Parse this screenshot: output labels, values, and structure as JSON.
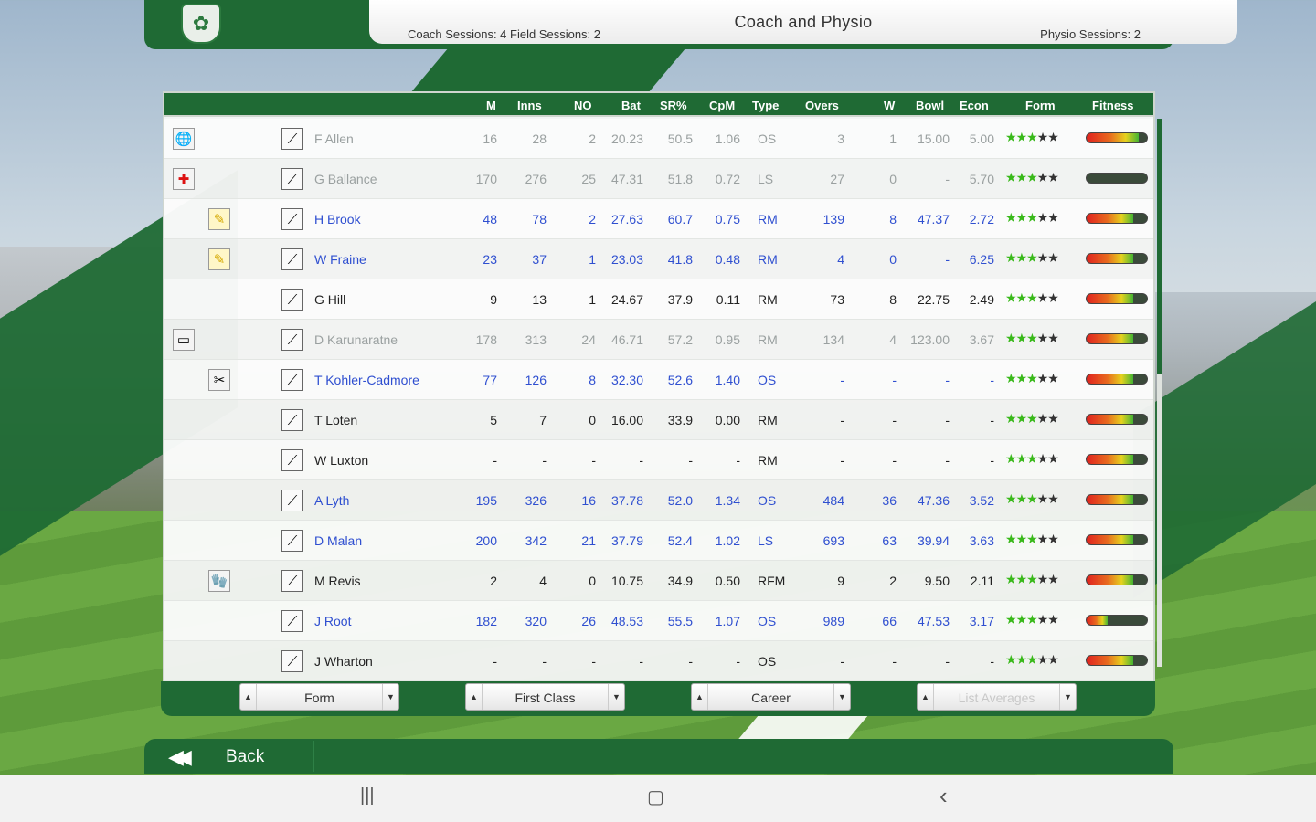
{
  "header": {
    "title": "Coach and Physio",
    "coach_field": "Coach Sessions: 4  Field Sessions: 2",
    "physio": "Physio Sessions: 2"
  },
  "columns": [
    "M",
    "Inns",
    "NO",
    "Bat",
    "SR%",
    "CpM",
    "Type",
    "Overs",
    "W",
    "Bowl",
    "Econ",
    "Form",
    "Fitness"
  ],
  "icons": {
    "globe": "globe-icon",
    "medical": "medical-cross-icon",
    "pencil": "pencil-icon",
    "bat": "bat-icon",
    "wicket": "wicket-icon",
    "keeper": "keeper-gloves-icon",
    "injury": "injury-icon",
    "card": "card-icon"
  },
  "rows": [
    {
      "icon1": "🌐",
      "icon2": "",
      "role": "⟋",
      "name": "F Allen",
      "m": "16",
      "inns": "28",
      "no": "2",
      "bat": "20.23",
      "sr": "50.5",
      "cpm": "1.06",
      "type": "OS",
      "overs": "3",
      "w": "1",
      "bowl": "15.00",
      "econ": "5.00",
      "form": 3,
      "fitness": 0.86,
      "style": "faded"
    },
    {
      "icon1": "✚",
      "icon2": "",
      "role": "⟋",
      "name": "G Ballance",
      "m": "170",
      "inns": "276",
      "no": "25",
      "bat": "47.31",
      "sr": "51.8",
      "cpm": "0.72",
      "type": "LS",
      "overs": "27",
      "w": "0",
      "bowl": "-",
      "econ": "5.70",
      "form": 3,
      "fitness": 0.0,
      "style": "faded"
    },
    {
      "icon1": "",
      "icon2": "✎",
      "role": "⟋",
      "name": "H Brook",
      "m": "48",
      "inns": "78",
      "no": "2",
      "bat": "27.63",
      "sr": "60.7",
      "cpm": "0.75",
      "type": "RM",
      "overs": "139",
      "w": "8",
      "bowl": "47.37",
      "econ": "2.72",
      "form": 3,
      "fitness": 0.78,
      "style": "blue"
    },
    {
      "icon1": "",
      "icon2": "✎",
      "role": "⟋",
      "name": "W Fraine",
      "m": "23",
      "inns": "37",
      "no": "1",
      "bat": "23.03",
      "sr": "41.8",
      "cpm": "0.48",
      "type": "RM",
      "overs": "4",
      "w": "0",
      "bowl": "-",
      "econ": "6.25",
      "form": 3,
      "fitness": 0.78,
      "style": "blue"
    },
    {
      "icon1": "",
      "icon2": "",
      "role": "⟋",
      "name": "G Hill",
      "m": "9",
      "inns": "13",
      "no": "1",
      "bat": "24.67",
      "sr": "37.9",
      "cpm": "0.11",
      "type": "RM",
      "overs": "73",
      "w": "8",
      "bowl": "22.75",
      "econ": "2.49",
      "form": 3,
      "fitness": 0.78,
      "style": "plain"
    },
    {
      "icon1": "▭",
      "icon2": "",
      "role": "⟋",
      "name": "D Karunaratne",
      "m": "178",
      "inns": "313",
      "no": "24",
      "bat": "46.71",
      "sr": "57.2",
      "cpm": "0.95",
      "type": "RM",
      "overs": "134",
      "w": "4",
      "bowl": "123.00",
      "econ": "3.67",
      "form": 3,
      "fitness": 0.78,
      "style": "faded"
    },
    {
      "icon1": "",
      "icon2": "✂",
      "role": "⟋",
      "name": "T Kohler-Cadmore",
      "m": "77",
      "inns": "126",
      "no": "8",
      "bat": "32.30",
      "sr": "52.6",
      "cpm": "1.40",
      "type": "OS",
      "overs": "-",
      "w": "-",
      "bowl": "-",
      "econ": "-",
      "form": 3,
      "fitness": 0.78,
      "style": "blue"
    },
    {
      "icon1": "",
      "icon2": "",
      "role": "⟋",
      "name": "T Loten",
      "m": "5",
      "inns": "7",
      "no": "0",
      "bat": "16.00",
      "sr": "33.9",
      "cpm": "0.00",
      "type": "RM",
      "overs": "-",
      "w": "-",
      "bowl": "-",
      "econ": "-",
      "form": 3,
      "fitness": 0.78,
      "style": "plain"
    },
    {
      "icon1": "",
      "icon2": "",
      "role": "⟋",
      "name": "W Luxton",
      "m": "-",
      "inns": "-",
      "no": "-",
      "bat": "-",
      "sr": "-",
      "cpm": "-",
      "type": "RM",
      "overs": "-",
      "w": "-",
      "bowl": "-",
      "econ": "-",
      "form": 3,
      "fitness": 0.78,
      "style": "plain"
    },
    {
      "icon1": "",
      "icon2": "",
      "role": "⟋",
      "name": "A Lyth",
      "m": "195",
      "inns": "326",
      "no": "16",
      "bat": "37.78",
      "sr": "52.0",
      "cpm": "1.34",
      "type": "OS",
      "overs": "484",
      "w": "36",
      "bowl": "47.36",
      "econ": "3.52",
      "form": 3,
      "fitness": 0.78,
      "style": "blue"
    },
    {
      "icon1": "",
      "icon2": "",
      "role": "⟋",
      "name": "D Malan",
      "m": "200",
      "inns": "342",
      "no": "21",
      "bat": "37.79",
      "sr": "52.4",
      "cpm": "1.02",
      "type": "LS",
      "overs": "693",
      "w": "63",
      "bowl": "39.94",
      "econ": "3.63",
      "form": 3,
      "fitness": 0.78,
      "style": "blue"
    },
    {
      "icon1": "",
      "icon2": "🧤",
      "role": "⟋",
      "name": "M Revis",
      "m": "2",
      "inns": "4",
      "no": "0",
      "bat": "10.75",
      "sr": "34.9",
      "cpm": "0.50",
      "type": "RFM",
      "overs": "9",
      "w": "2",
      "bowl": "9.50",
      "econ": "2.11",
      "form": 3,
      "fitness": 0.78,
      "style": "plain"
    },
    {
      "icon1": "",
      "icon2": "",
      "role": "⟋",
      "name": "J Root",
      "m": "182",
      "inns": "320",
      "no": "26",
      "bat": "48.53",
      "sr": "55.5",
      "cpm": "1.07",
      "type": "OS",
      "overs": "989",
      "w": "66",
      "bowl": "47.53",
      "econ": "3.17",
      "form": 3,
      "fitness": 0.35,
      "style": "blue"
    },
    {
      "icon1": "",
      "icon2": "",
      "role": "⟋",
      "name": "J Wharton",
      "m": "-",
      "inns": "-",
      "no": "-",
      "bat": "-",
      "sr": "-",
      "cpm": "-",
      "type": "OS",
      "overs": "-",
      "w": "-",
      "bowl": "-",
      "econ": "-",
      "form": 3,
      "fitness": 0.78,
      "style": "plain"
    }
  ],
  "filters": [
    {
      "label": "Form"
    },
    {
      "label": "First Class"
    },
    {
      "label": "Career"
    },
    {
      "label": "List Averages"
    }
  ],
  "back_label": "Back",
  "nav": {
    "recents": "|||",
    "home": "▢",
    "back": "‹"
  },
  "colors": {
    "accent": "#1f6a34",
    "link": "#2f4fd0",
    "star_green": "#39b91a"
  }
}
